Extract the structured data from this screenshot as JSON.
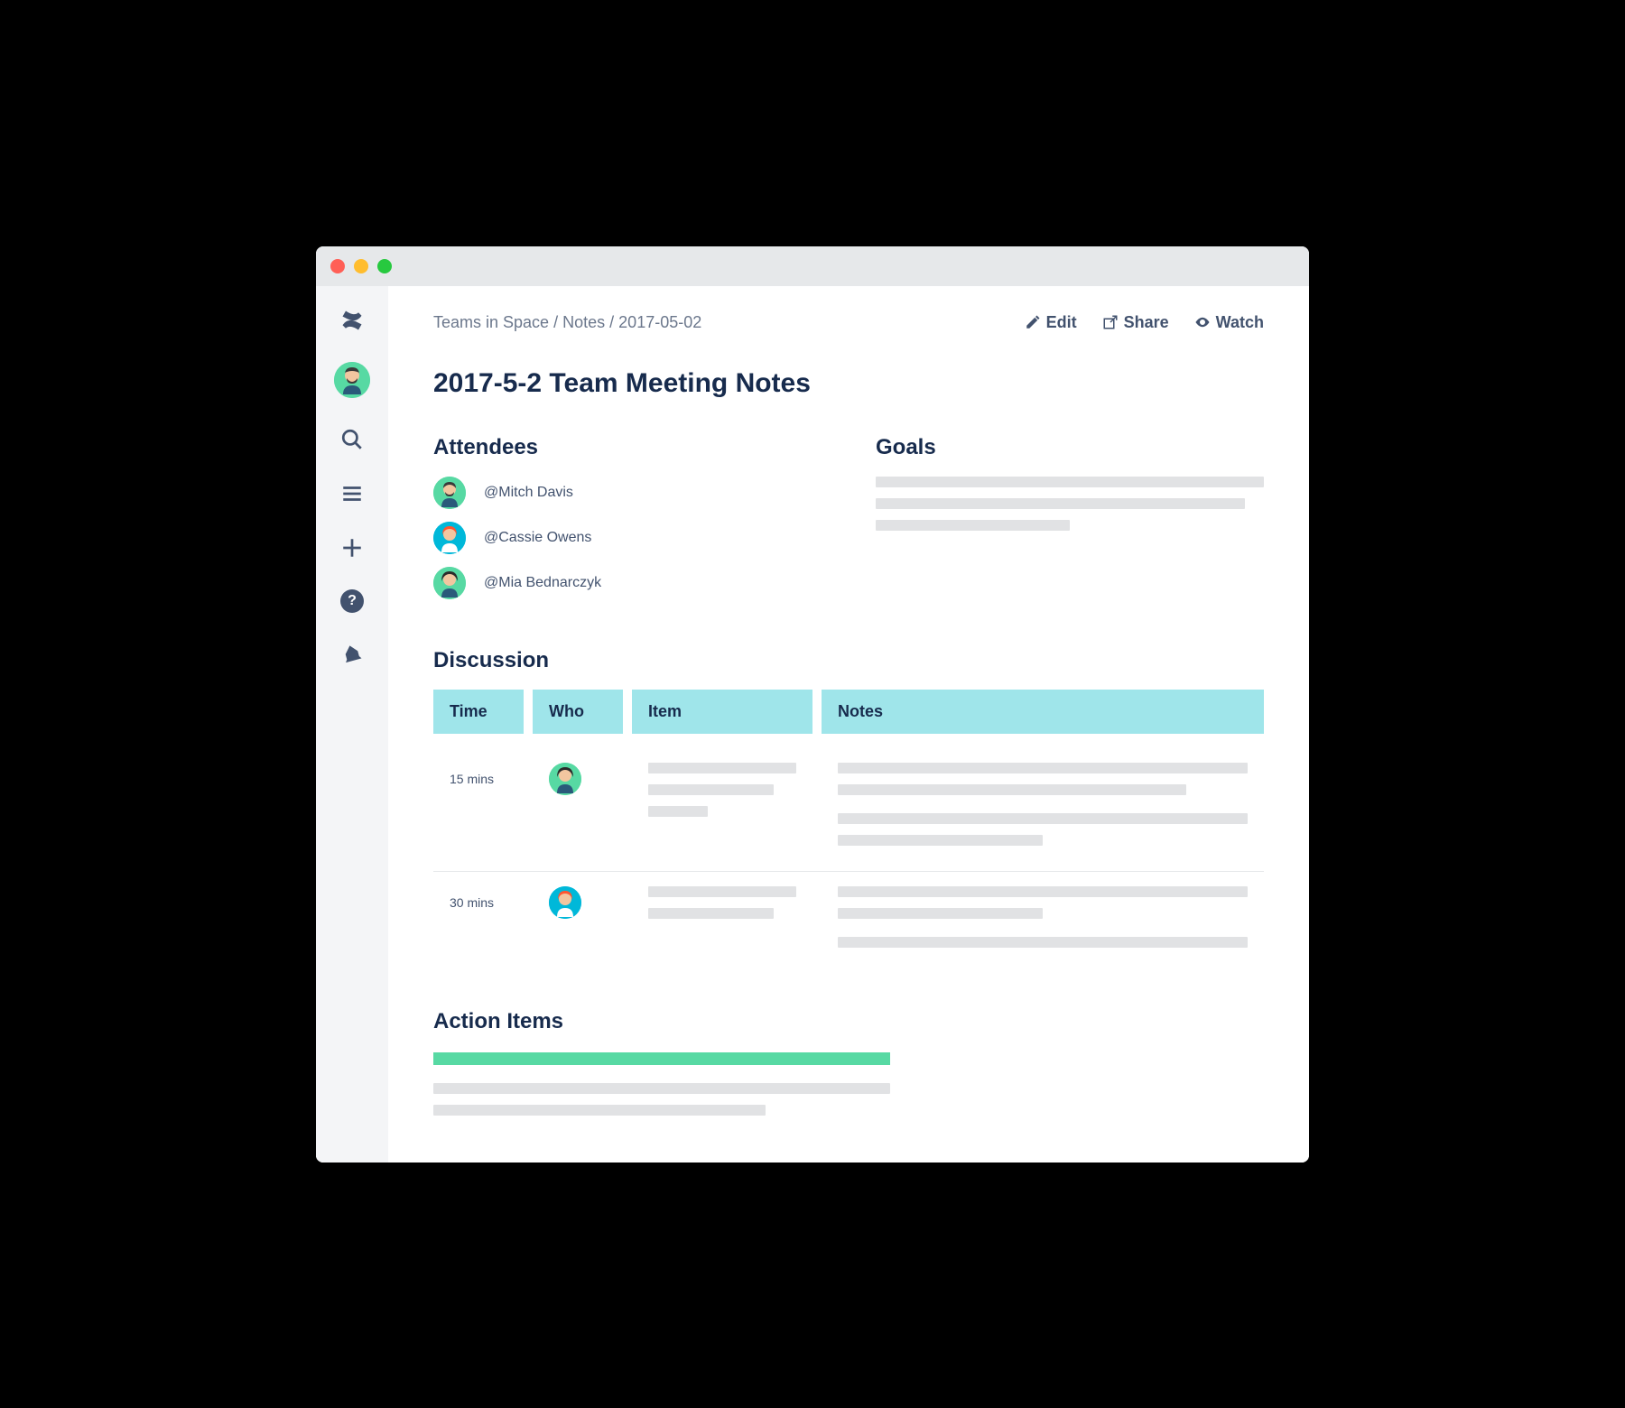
{
  "breadcrumb": {
    "space": "Teams in Space",
    "section": "Notes",
    "page": "2017-05-02"
  },
  "actions": {
    "edit": "Edit",
    "share": "Share",
    "watch": "Watch"
  },
  "title": "2017-5-2 Team Meeting Notes",
  "attendees": {
    "heading": "Attendees",
    "items": [
      {
        "name": "@Mitch Davis",
        "avatar": "male-beard",
        "bg": "green"
      },
      {
        "name": "@Cassie Owens",
        "avatar": "female-orange",
        "bg": "blue"
      },
      {
        "name": "@Mia Bednarczyk",
        "avatar": "female-dark",
        "bg": "green"
      }
    ]
  },
  "goals": {
    "heading": "Goals"
  },
  "discussion": {
    "heading": "Discussion",
    "columns": {
      "time": "Time",
      "who": "Who",
      "item": "Item",
      "notes": "Notes"
    },
    "rows": [
      {
        "time": "15 mins",
        "who_avatar": "female-dark",
        "who_bg": "green"
      },
      {
        "time": "30 mins",
        "who_avatar": "female-orange",
        "who_bg": "blue"
      }
    ]
  },
  "action_items": {
    "heading": "Action Items"
  }
}
